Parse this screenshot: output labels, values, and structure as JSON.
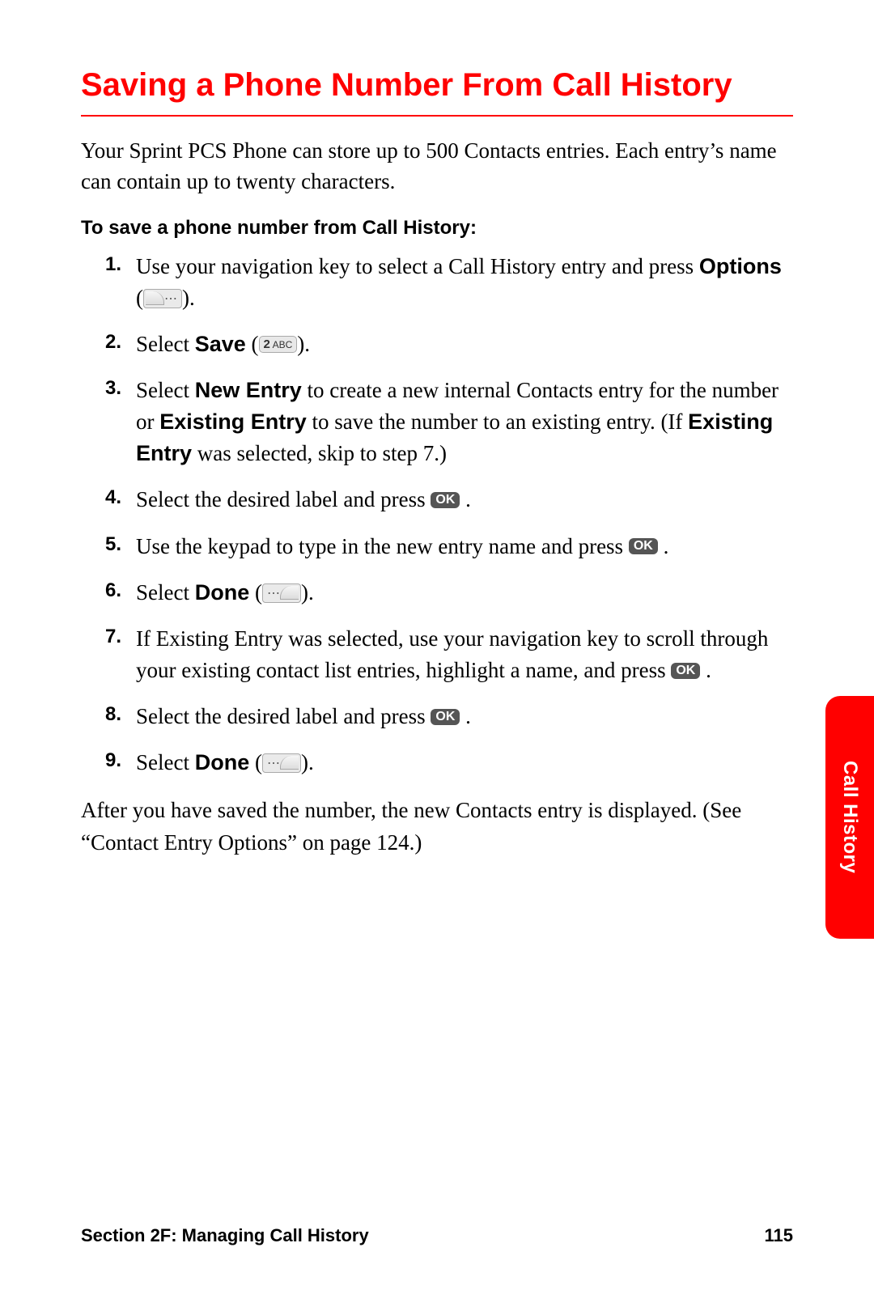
{
  "title": "Saving a Phone Number From Call History",
  "intro": "Your Sprint PCS Phone can store up to 500 Contacts entries. Each entry’s name can contain up to twenty characters.",
  "subhead": "To save a phone number from Call History:",
  "steps": {
    "s1": {
      "num": "1.",
      "a": "Use your navigation key to select a Call History entry and press ",
      "b": "Options",
      "c": " ("
    },
    "s2": {
      "num": "2.",
      "a": "Select ",
      "b": "Save",
      "c": " ("
    },
    "s3": {
      "num": "3.",
      "a": "Select ",
      "b": "New Entry",
      "c": " to create a new internal Contacts entry for the number or ",
      "d": "Existing Entry",
      "e": " to save the number to an existing entry. (If ",
      "f": "Existing Entry",
      "g": " was selected, skip to step 7.)"
    },
    "s4": {
      "num": "4.",
      "a": "Select the desired label and press "
    },
    "s5": {
      "num": "5.",
      "a": "Use the keypad to type in the new entry name and press "
    },
    "s6": {
      "num": "6.",
      "a": "Select ",
      "b": "Done",
      "c": " ("
    },
    "s7": {
      "num": "7.",
      "a": "If Existing Entry was selected, use your navigation key to scroll through your existing contact list entries, highlight a name, and press "
    },
    "s8": {
      "num": "8.",
      "a": "Select the desired label and press "
    },
    "s9": {
      "num": "9.",
      "a": "Select ",
      "b": "Done",
      "c": " ("
    }
  },
  "closing": "After you have saved the number, the new Contacts entry is displayed. (See “Contact Entry Options” on page 124.)",
  "footer": {
    "section": "Section 2F: Managing Call History",
    "page": "115"
  },
  "sidetab": "Call History",
  "icons": {
    "ok": "OK",
    "key2": "2",
    "key2abc": "ABC",
    "paren_close": ")."
  }
}
